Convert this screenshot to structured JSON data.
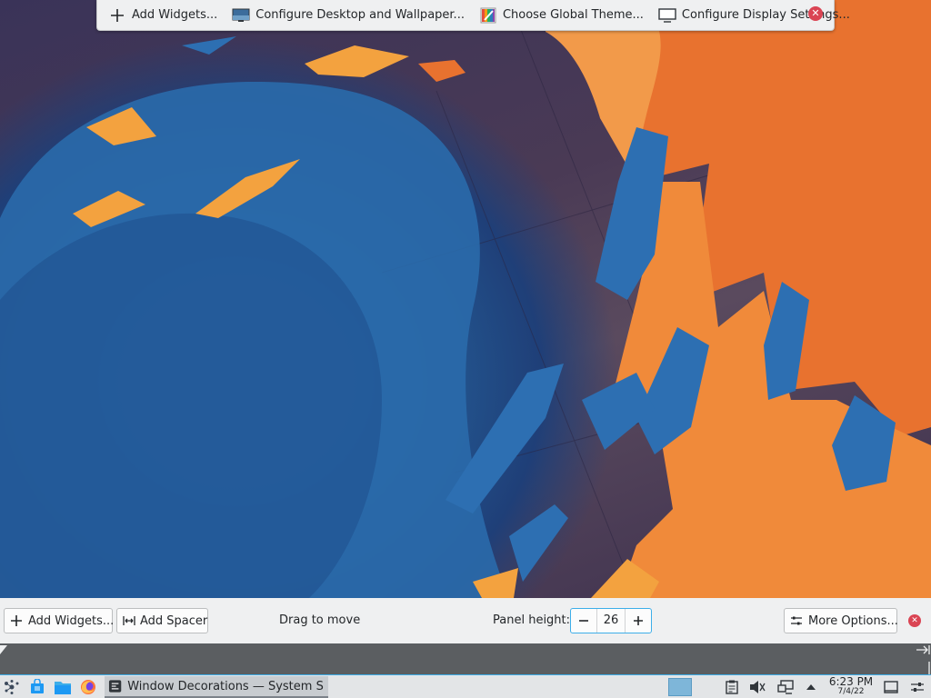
{
  "desktop_toolbar": {
    "add_widgets": "Add Widgets...",
    "configure_desktop": "Configure Desktop and Wallpaper...",
    "choose_theme": "Choose Global Theme...",
    "configure_display": "Configure Display Settings..."
  },
  "panel_config": {
    "add_widgets": "Add Widgets...",
    "add_spacer": "Add Spacer",
    "drag_to_move": "Drag to move",
    "panel_height_label": "Panel height:",
    "panel_height_value": "26",
    "more_options": "More Options..."
  },
  "taskbar": {
    "task_title": "Window Decorations — System S...",
    "clock_time": "6:23 PM",
    "clock_date": "7/4/22"
  },
  "colors": {
    "accent": "#3daee9",
    "close": "#da4453",
    "orange": "#f08a3a",
    "blue": "#2f79b8"
  }
}
